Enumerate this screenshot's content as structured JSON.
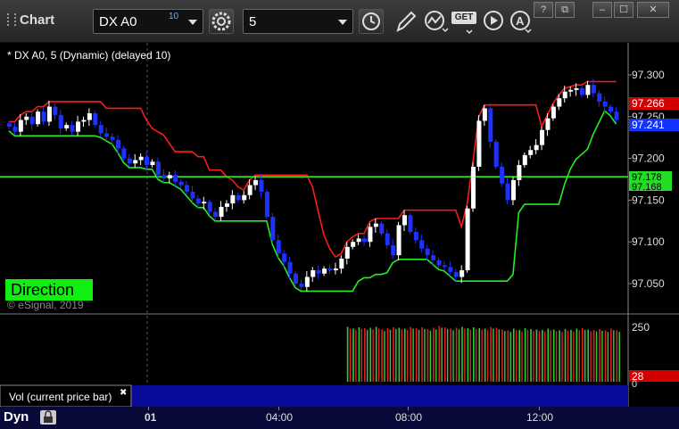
{
  "toolbar": {
    "app_title": "Chart",
    "symbol": "DX A0",
    "delay": "10",
    "interval": "5",
    "get_label": "GET",
    "window_buttons": [
      "?",
      "⧉",
      "–",
      "☐",
      "✕"
    ]
  },
  "chart_header": "* DX A0, 5 (Dynamic) (delayed 10)",
  "indicator_label": "Direction",
  "copyright": "© eSignal, 2019",
  "volume_panel": {
    "label": "Vol (current price bar)",
    "close_glyph": "✖",
    "scale": [
      "250",
      "0"
    ],
    "current": "28"
  },
  "price_labels": {
    "last_red": "97.266",
    "last_blue": "97.241",
    "green_1": "97.178",
    "green_2": "97.168"
  },
  "footer": {
    "dyn_label": "Dyn"
  },
  "colors": {
    "up": "#ffffff",
    "down": "#1e32ff",
    "red_line": "#ff1a1a",
    "green_line": "#22ee22",
    "price_red_bg": "#d40000",
    "price_blue_bg": "#1432ff",
    "price_green_bg": "#22dd22",
    "direction_bg": "#11ee11"
  },
  "chart_data": {
    "type": "candlestick",
    "y_ticks": [
      "97.300",
      "97.250",
      "97.200",
      "97.150",
      "97.100",
      "97.050"
    ],
    "x_ticks": [
      "01",
      "04:00",
      "08:00",
      "12:00"
    ],
    "ylim": [
      97.03,
      97.31
    ],
    "volume_ylim": [
      0,
      300
    ],
    "closes": [
      97.238,
      97.232,
      97.246,
      97.25,
      97.241,
      97.256,
      97.244,
      97.262,
      97.252,
      97.236,
      97.24,
      97.232,
      97.244,
      97.246,
      97.254,
      97.24,
      97.23,
      97.226,
      97.222,
      97.212,
      97.2,
      97.194,
      97.198,
      97.202,
      97.192,
      97.196,
      97.18,
      97.176,
      97.18,
      97.172,
      97.168,
      97.16,
      97.152,
      97.146,
      97.148,
      97.136,
      97.13,
      97.142,
      97.146,
      97.156,
      97.15,
      97.156,
      97.168,
      97.174,
      97.16,
      97.13,
      97.102,
      97.086,
      97.076,
      97.062,
      97.05,
      97.046,
      97.058,
      97.066,
      97.062,
      97.068,
      97.066,
      97.068,
      97.08,
      97.094,
      97.1,
      97.104,
      97.1,
      97.118,
      97.122,
      97.11,
      97.096,
      97.084,
      97.12,
      97.132,
      97.112,
      97.102,
      97.092,
      97.084,
      97.078,
      97.072,
      97.07,
      97.064,
      97.058,
      97.066,
      97.14,
      97.19,
      97.245,
      97.26,
      97.22,
      97.19,
      97.17,
      97.15,
      97.174,
      97.192,
      97.204,
      97.21,
      97.216,
      97.234,
      97.248,
      97.262,
      97.272,
      97.28,
      97.282,
      97.284,
      97.276,
      97.288,
      97.278,
      97.268,
      97.262,
      97.256,
      97.246
    ],
    "vol_start_index": 59,
    "volumes": [
      252,
      244,
      250,
      246,
      248,
      252,
      240,
      246,
      250,
      248,
      244,
      252,
      246,
      250,
      242,
      248,
      256,
      250,
      244,
      248,
      252,
      246,
      250,
      246,
      244,
      252,
      248,
      240,
      236,
      244,
      238,
      246,
      242,
      240,
      238,
      244,
      240,
      236,
      242,
      238,
      244,
      246,
      240,
      238,
      242,
      236,
      244,
      236
    ]
  }
}
